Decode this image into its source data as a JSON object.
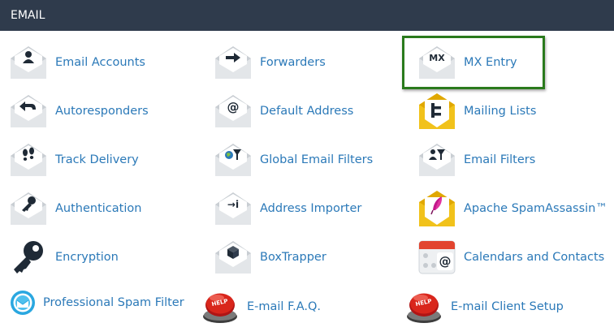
{
  "section": {
    "title": "EMAIL"
  },
  "items": [
    {
      "label": "Email Accounts",
      "icon": "user-envelope-icon"
    },
    {
      "label": "Forwarders",
      "icon": "arrow-envelope-icon"
    },
    {
      "label": "MX Entry",
      "icon": "mx-envelope-icon",
      "glyph": "MX",
      "highlighted": true
    },
    {
      "label": "Autoresponders",
      "icon": "reply-envelope-icon"
    },
    {
      "label": "Default Address",
      "icon": "at-envelope-icon",
      "glyph": "@"
    },
    {
      "label": "Mailing Lists",
      "icon": "mailing-list-icon"
    },
    {
      "label": "Track Delivery",
      "icon": "footprints-envelope-icon"
    },
    {
      "label": "Global Email Filters",
      "icon": "global-filter-envelope-icon"
    },
    {
      "label": "Email Filters",
      "icon": "filter-envelope-icon"
    },
    {
      "label": "Authentication",
      "icon": "key-envelope-icon"
    },
    {
      "label": "Address Importer",
      "icon": "import-envelope-icon",
      "glyph": "→i"
    },
    {
      "label": "Apache SpamAssassin™",
      "icon": "feather-envelope-icon"
    },
    {
      "label": "Encryption",
      "icon": "key-icon"
    },
    {
      "label": "BoxTrapper",
      "icon": "box-envelope-icon"
    },
    {
      "label": "Calendars and Contacts",
      "icon": "calendar-icon",
      "glyph": "@"
    },
    {
      "label": "Professional Spam Filter",
      "icon": "spam-filter-icon"
    },
    {
      "label": "E-mail F.A.Q.",
      "icon": "help-button-icon",
      "glyph": "HELP"
    },
    {
      "label": "E-mail Client Setup",
      "icon": "help-button-icon",
      "glyph": "HELP"
    }
  ],
  "colors": {
    "header_bg": "#2f3b4c",
    "link": "#2b79b8",
    "highlight_border": "#2a7a1c",
    "mailing_yellow": "#f1c21b",
    "help_red": "#d9261c"
  }
}
